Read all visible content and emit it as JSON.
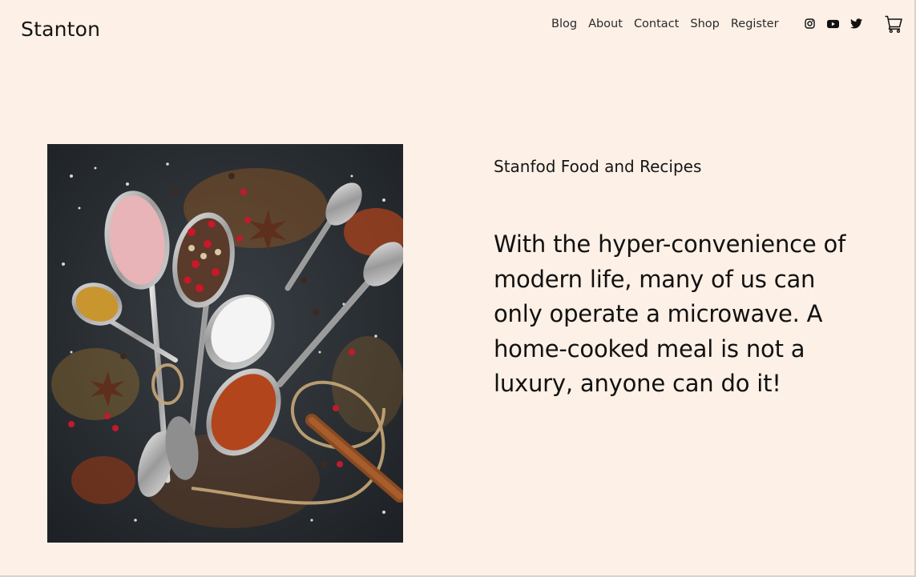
{
  "header": {
    "logo": "Stanton",
    "nav": [
      {
        "label": "Blog"
      },
      {
        "label": "About"
      },
      {
        "label": "Contact"
      },
      {
        "label": "Shop"
      },
      {
        "label": "Register"
      }
    ],
    "social_icons": [
      "instagram-icon",
      "youtube-icon",
      "twitter-icon"
    ],
    "cart_icon": "cart-icon"
  },
  "hero": {
    "subtitle": "Stanfod Food and Recipes",
    "quote": "With the hyper-convenience of modern life, many of us can only operate a microwave. A home-cooked meal is not a luxury, anyone can do it!"
  },
  "colors": {
    "background": "#fdf0e6",
    "text": "#111111",
    "image_background": "#23272c"
  }
}
